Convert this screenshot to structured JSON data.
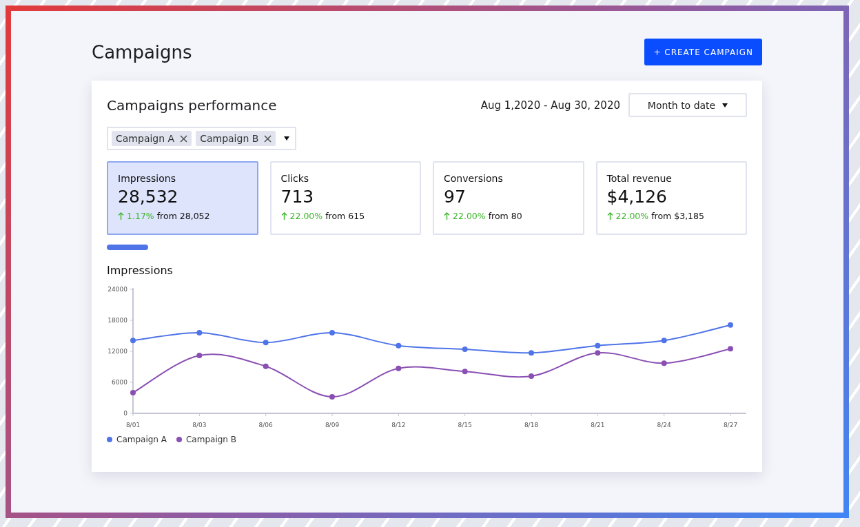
{
  "page": {
    "title": "Campaigns",
    "create_button": "+ CREATE CAMPAIGN"
  },
  "performance": {
    "title": "Campaigns performance",
    "date_range": "Aug 1,2020 - Aug 30, 2020",
    "period_select": "Month to date",
    "campaign_tags": [
      {
        "label": "Campaign A"
      },
      {
        "label": "Campaign B"
      }
    ],
    "metrics": [
      {
        "label": "Impressions",
        "value": "28,532",
        "change": "1.17%",
        "from": "from 28,052",
        "selected": true
      },
      {
        "label": "Clicks",
        "value": "713",
        "change": "22.00%",
        "from": "from 615",
        "selected": false
      },
      {
        "label": "Conversions",
        "value": "97",
        "change": "22.00%",
        "from": "from 80",
        "selected": false
      },
      {
        "label": "Total revenue",
        "value": "$4,126",
        "change": "22.00%",
        "from": "from $3,185",
        "selected": false
      }
    ],
    "chart_title": "Impressions",
    "chart_data": {
      "type": "line",
      "categories": [
        "8/01",
        "8/03",
        "8/06",
        "8/09",
        "8/12",
        "8/15",
        "8/18",
        "8/21",
        "8/24",
        "8/27"
      ],
      "ylim": [
        0,
        24000
      ],
      "yticks": [
        0,
        6000,
        12000,
        18000,
        24000
      ],
      "series": [
        {
          "name": "Campaign A",
          "color": "#4f74e8",
          "marker": "circle",
          "values": [
            14100,
            15600,
            13700,
            15600,
            13100,
            12400,
            11700,
            13100,
            14100,
            17100
          ]
        },
        {
          "name": "Campaign B",
          "color": "#8a4fb3",
          "marker": "circle",
          "values": [
            4000,
            11200,
            9100,
            3200,
            8700,
            8100,
            7200,
            11700,
            9700,
            12500
          ]
        }
      ]
    }
  }
}
